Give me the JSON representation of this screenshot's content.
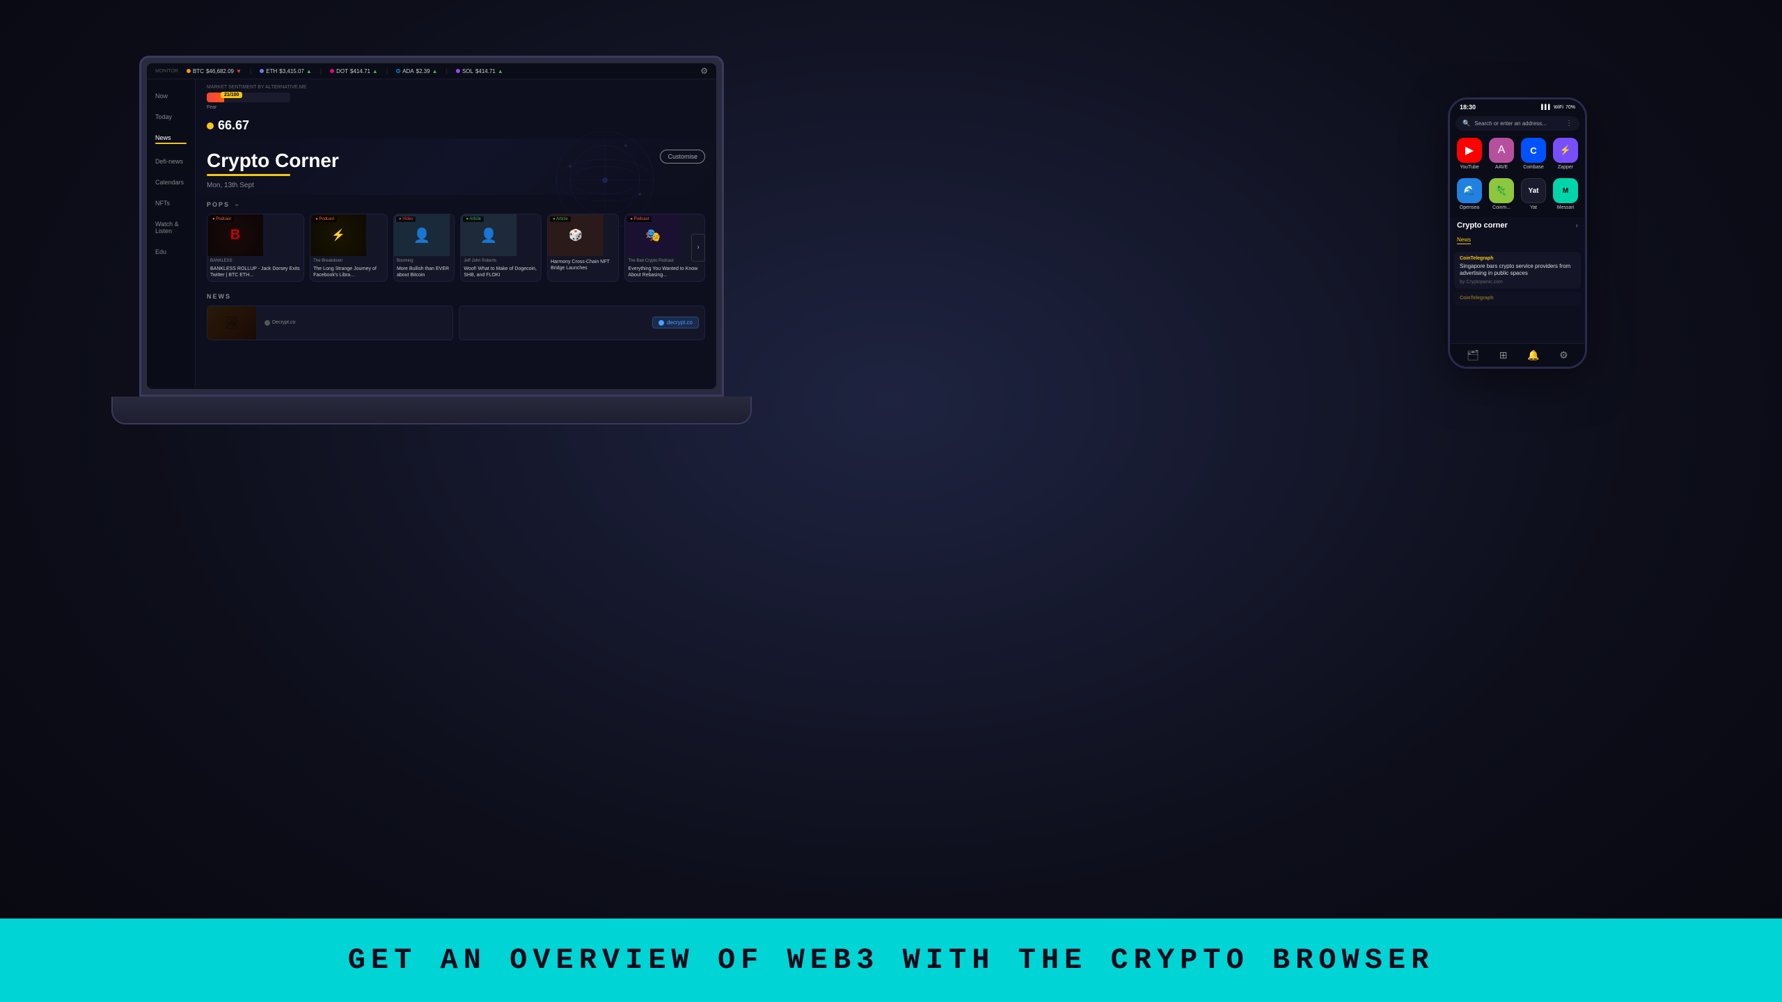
{
  "page": {
    "background_color": "#1a1a2e",
    "bottom_banner": {
      "text": "GET AN OVERVIEW OF WEB3 WITH THE CRYPTO BROWSER",
      "bg_color": "#00d4d4",
      "text_color": "#0a0a1a"
    }
  },
  "laptop": {
    "ticker": {
      "label": "MONITOR",
      "items": [
        {
          "coin": "BTC",
          "price": "$46,682.09",
          "change": "down",
          "color": "btc"
        },
        {
          "coin": "ETH",
          "price": "$3,415.07",
          "change": "up",
          "color": "eth"
        },
        {
          "coin": "DOT",
          "price": "$414.71",
          "change": "up",
          "color": "dot"
        },
        {
          "coin": "ADA",
          "price": "$2.39",
          "change": "up",
          "color": "ada"
        },
        {
          "coin": "SOL",
          "price": "$414.71",
          "change": "up",
          "color": "sol"
        }
      ]
    },
    "sidebar": {
      "items": [
        {
          "label": "Now",
          "active": false
        },
        {
          "label": "Today",
          "active": false
        },
        {
          "label": "News",
          "active": true
        },
        {
          "label": "Defi-news",
          "active": false
        },
        {
          "label": "Calendars",
          "active": false
        },
        {
          "label": "NFTs",
          "active": false
        },
        {
          "label": "Watch & Listen",
          "active": false
        },
        {
          "label": "Edu",
          "active": false
        }
      ]
    },
    "market_sentiment": {
      "label": "MARKET SENTIMENT by alternative.me",
      "badge_value": "21/100",
      "bar_fill_percent": 21,
      "fear_label": "Fear",
      "gas_value": "66.67"
    },
    "hero": {
      "title": "Crypto Corner",
      "underline_color": "#f5c518",
      "date": "Mon, 13th Sept",
      "customise_label": "Customise"
    },
    "pops": {
      "label": "POPS",
      "cards": [
        {
          "type": "Podcast",
          "title": "BANKLESS ROLLUP - Jack Dorsey Exits Twitter | BTC ETH...",
          "thumb_class": "thumb-bankless",
          "source": "BANKLESS"
        },
        {
          "type": "Podcast",
          "title": "The Long Strange Journey of Facebook's Libra...",
          "thumb_class": "thumb-breakdown",
          "source": "The Breakdown"
        },
        {
          "type": "Video",
          "title": "More Bullish than EVER about Bitcoin",
          "thumb_class": "thumb-booming",
          "source": "Booming"
        },
        {
          "type": "Article",
          "title": "Woof! What to Make of Dogecoin, SHB, and FLOKI",
          "thumb_class": "thumb-jeff",
          "source": "Jeff John Roberts"
        },
        {
          "type": "Article",
          "title": "Harmony Cross-Chain NFT Bridge Launches",
          "thumb_class": "thumb-harmony",
          "source": ""
        },
        {
          "type": "Podcast",
          "title": "Everything You Wanted to Know About Rebasing...",
          "thumb_class": "thumb-bad-crypto",
          "source": "The Bad Crypto Podcast"
        }
      ]
    },
    "news": {
      "label": "NEWS",
      "items": [
        {
          "source": "Decrypt.co",
          "thumb": "news-thumb-1"
        },
        {
          "source": "Decrypt.co",
          "thumb": "news-thumb-2"
        }
      ]
    }
  },
  "phone": {
    "status_bar": {
      "time": "18:30",
      "icons": "▌▌▌ WiFi 70%"
    },
    "url_bar": {
      "placeholder": "Search or enter an address...",
      "menu_icon": "⋮"
    },
    "apps_row1": [
      {
        "label": "YouTube",
        "class": "app-youtube",
        "icon": "▶"
      },
      {
        "label": "AAVE",
        "class": "app-aave",
        "icon": "A"
      },
      {
        "label": "Coinbase",
        "class": "app-coinbase",
        "icon": "C"
      },
      {
        "label": "Zapper",
        "class": "app-zapper",
        "icon": "Z"
      }
    ],
    "apps_row2": [
      {
        "label": "Opensea",
        "class": "app-opensea",
        "icon": "O"
      },
      {
        "label": "Coinm...",
        "class": "app-coingecko",
        "icon": "🦎"
      },
      {
        "label": "Yat",
        "class": "app-yat",
        "icon": "Y"
      },
      {
        "label": "Messari",
        "class": "app-messari",
        "icon": "M"
      }
    ],
    "crypto_corner": {
      "title": "Crypto corner",
      "arrow": "›",
      "tab_news": "News",
      "news_items": [
        {
          "source": "CoinTelegraph",
          "headline": "Singapore bars crypto service providers from advertising in public spaces",
          "byline": "by Cryptopanic.com"
        },
        {
          "source": "CoinTelegraph",
          "headline": "",
          "byline": ""
        }
      ]
    },
    "bottom_bar": {
      "icons": [
        "🗂",
        "⊞",
        "🔔",
        "⚙"
      ]
    }
  }
}
